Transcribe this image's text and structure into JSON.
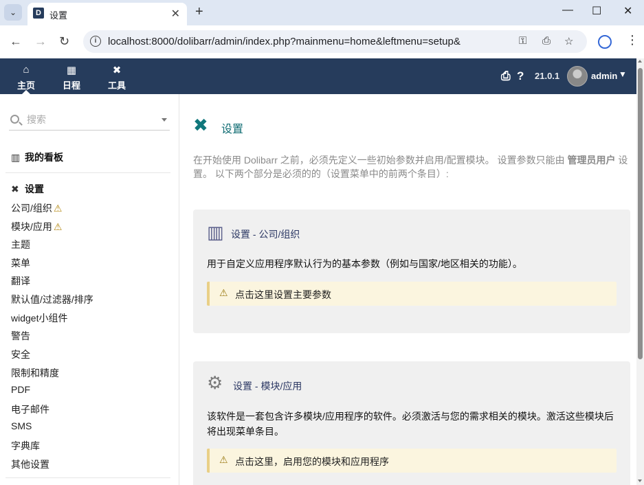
{
  "browser": {
    "tab_title": "设置",
    "favicon_letter": "D",
    "tab_close": "✕",
    "new_tab": "+",
    "url": "localhost:8000/dolibarr/admin/index.php?mainmenu=home&leftmenu=setup&",
    "window_controls": {
      "minimize": "—",
      "maximize": "☐",
      "close": "✕"
    }
  },
  "header": {
    "menus": [
      {
        "label": "主页",
        "icon": "home-icon"
      },
      {
        "label": "日程",
        "icon": "calendar-icon"
      },
      {
        "label": "工具",
        "icon": "tools-icon"
      }
    ],
    "version": "21.0.1",
    "username": "admin"
  },
  "sidebar": {
    "search_placeholder": "搜索",
    "dashboard_label": "我的看板",
    "setup_label": "设置",
    "items": [
      {
        "label": "公司/组织",
        "warn": true
      },
      {
        "label": "模块/应用",
        "warn": true
      },
      {
        "label": "主题"
      },
      {
        "label": "菜单"
      },
      {
        "label": "翻译"
      },
      {
        "label": "默认值/过滤器/排序"
      },
      {
        "label": "widget小组件"
      },
      {
        "label": "警告"
      },
      {
        "label": "安全"
      },
      {
        "label": "限制和精度"
      },
      {
        "label": "PDF"
      },
      {
        "label": "电子邮件"
      },
      {
        "label": "SMS"
      },
      {
        "label": "字典库"
      },
      {
        "label": "其他设置"
      }
    ]
  },
  "main": {
    "title": "设置",
    "intro_part1": "在开始使用 Dolibarr 之前，必须先定义一些初始参数并启用/配置模块。 设置参数只能由 ",
    "intro_bold": "管理员用户",
    "intro_part2": " 设置。 以下两个部分是必须的的（设置菜单中的前两个条目）:",
    "cards": [
      {
        "title": "设置 - 公司/组织",
        "description": "用于自定义应用程序默认行为的基本参数（例如与国家/地区相关的功能）。",
        "link": "点击这里设置主要参数"
      },
      {
        "title": "设置 - 模块/应用",
        "description": "该软件是一套包含许多模块/应用程序的软件。必须激活与您的需求相关的模块。激活这些模块后将出现菜单条目。",
        "link": "点击这里，启用您的模块和应用程序"
      }
    ]
  }
}
